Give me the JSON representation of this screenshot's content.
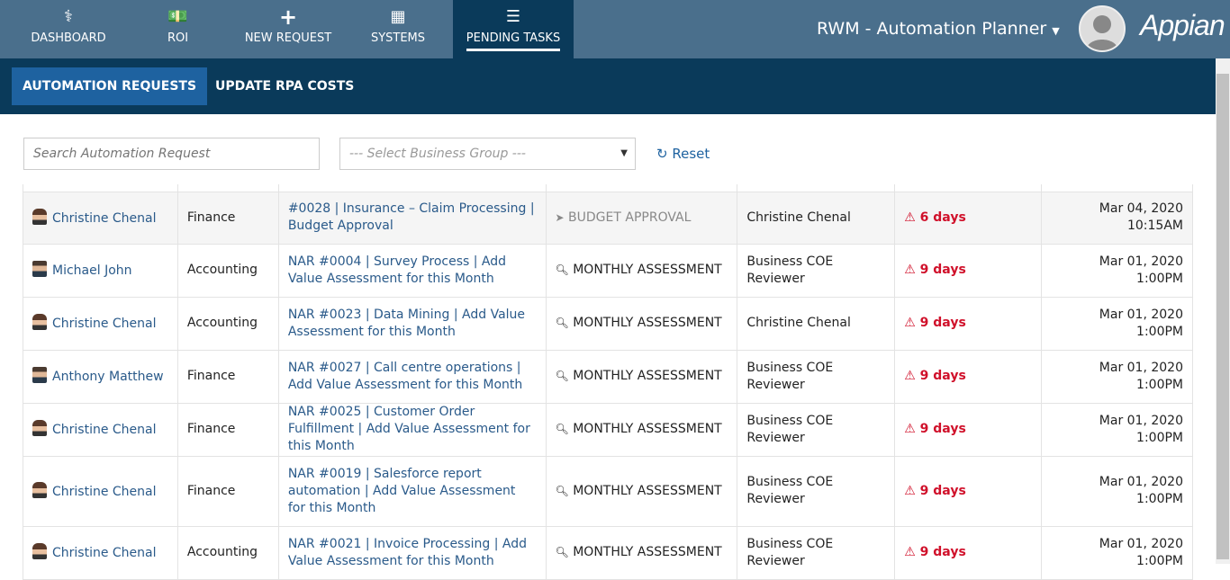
{
  "nav": {
    "items": [
      {
        "label": "DASHBOARD",
        "icon": "stethoscope-icon"
      },
      {
        "label": "ROI",
        "icon": "money-icon"
      },
      {
        "label": "NEW REQUEST",
        "icon": "plus-icon"
      },
      {
        "label": "SYSTEMS",
        "icon": "grid-icon"
      },
      {
        "label": "PENDING TASKS",
        "icon": "tasks-icon",
        "active": true
      }
    ],
    "app_name": "RWM - Automation Planner",
    "logo": "Appian"
  },
  "subnav": {
    "tabs": [
      {
        "label": "AUTOMATION REQUESTS",
        "active": true
      },
      {
        "label": "UPDATE RPA COSTS"
      }
    ]
  },
  "filters": {
    "search_placeholder": "Search Automation Request",
    "select_placeholder": "--- Select Business Group ---",
    "reset_label": "Reset"
  },
  "rows": [
    {
      "user": "Christine Chenal",
      "avatar": "female",
      "group": "Finance",
      "request": "#0028 | Insurance – Claim Processing | Budget Approval",
      "task_icon": "paper-plane-icon",
      "task": "BUDGET APPROVAL",
      "assignee": "Christine Chenal",
      "overdue": "6 days",
      "date": "Mar 04, 2020 10:15AM"
    },
    {
      "user": "Michael John",
      "avatar": "male",
      "group": "Accounting",
      "request": "NAR #0004 | Survey Process | Add Value Assessment for this Month",
      "task_icon": "search-icon",
      "task": "MONTHLY ASSESSMENT",
      "assignee": "Business COE Reviewer",
      "overdue": "9 days",
      "date": "Mar 01, 2020 1:00PM"
    },
    {
      "user": "Christine Chenal",
      "avatar": "female",
      "group": "Accounting",
      "request": "NAR #0023 | Data Mining | Add Value Assessment for this Month",
      "task_icon": "search-icon",
      "task": "MONTHLY ASSESSMENT",
      "assignee": "Christine Chenal",
      "overdue": "9 days",
      "date": "Mar 01, 2020 1:00PM"
    },
    {
      "user": "Anthony Matthew",
      "avatar": "male",
      "group": "Finance",
      "request": "NAR #0027 | Call centre operations | Add Value Assessment for this Month",
      "task_icon": "search-icon",
      "task": "MONTHLY ASSESSMENT",
      "assignee": "Business COE Reviewer",
      "overdue": "9 days",
      "date": "Mar 01, 2020 1:00PM"
    },
    {
      "user": "Christine Chenal",
      "avatar": "female",
      "group": "Finance",
      "request": "NAR #0025 | Customer Order Fulfillment | Add Value Assessment for this Month",
      "task_icon": "search-icon",
      "task": "MONTHLY ASSESSMENT",
      "assignee": "Business COE Reviewer",
      "overdue": "9 days",
      "date": "Mar 01, 2020 1:00PM"
    },
    {
      "user": "Christine Chenal",
      "avatar": "female",
      "group": "Finance",
      "request": "NAR #0019 | Salesforce report automation | Add Value Assessment for this Month",
      "task_icon": "search-icon",
      "task": "MONTHLY ASSESSMENT",
      "assignee": "Business COE Reviewer",
      "overdue": "9 days",
      "date": "Mar 01, 2020 1:00PM"
    },
    {
      "user": "Christine Chenal",
      "avatar": "female",
      "group": "Accounting",
      "request": "NAR #0021 | Invoice Processing | Add Value Assessment for this Month",
      "task_icon": "search-icon",
      "task": "MONTHLY ASSESSMENT",
      "assignee": "Business COE Reviewer",
      "overdue": "9 days",
      "date": "Mar 01, 2020 1:00PM"
    }
  ],
  "colors": {
    "topnav": "#4a6f8c",
    "subnav": "#0a3a5a",
    "active_tab": "#1e62a0",
    "link": "#2a5a8a",
    "warning": "#d0102a"
  }
}
